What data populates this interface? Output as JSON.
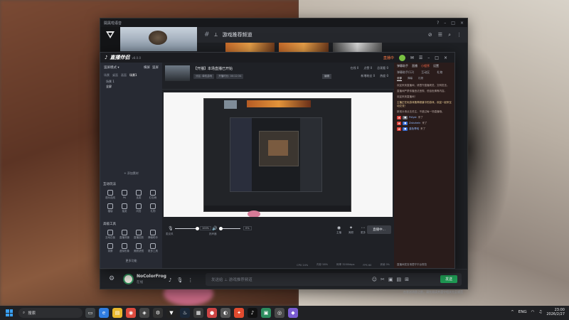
{
  "back_window": {
    "title": "開黑啦语音",
    "channel_name": "游戏推荐频道",
    "channel_prefix": "⊥",
    "input_placeholder": "发送给 ⊥ 游戏推荐频道",
    "send_label": "发送",
    "user": {
      "name": "NoColorFrog",
      "status": "在线"
    },
    "bottom_hint": "在发送消息之前，请先阅读并遵守相关社区规范"
  },
  "front_window": {
    "app_name": "直播伴侣",
    "version": "v8.0.0",
    "live_tag": "直播中",
    "mode_label": "竖屏模式 ▾",
    "mode_tabs": [
      "横屏",
      "竖屏"
    ],
    "scene_tabs": [
      "场景",
      "桌面",
      "画面",
      "场景1"
    ],
    "scenes": [
      {
        "label": "场景 1",
        "selected": false
      },
      {
        "label": "全屏",
        "selected": true
      }
    ],
    "add_source": "+ 添加素材",
    "interact_title": "互动玩法",
    "interact_items": [
      "观众连线",
      "PK",
      "连麦",
      "红包雨",
      "福袋",
      "抽奖",
      "问答",
      "礼物"
    ],
    "tools_title": "高级工具",
    "tools_items": [
      "互动白板",
      "直播测速",
      "直播回放",
      "弹幕助手",
      "录屏",
      "虚拟形象",
      "美颜滤镜",
      "更多工具"
    ],
    "more_label": "更多功能",
    "room_title": "【开播】本场直播已开始",
    "room_tags": [
      "分区: 单机游戏",
      "开播时长: 00:12:34"
    ],
    "room_edit": "编辑",
    "room_stats": [
      "在线 0",
      "点赞 0",
      "总观看 0"
    ],
    "room_stats2": [
      "新增粉丝 0",
      "热度 0"
    ],
    "mic_label": "麦克风",
    "mic_pct": "100%",
    "speaker_label": "扬声器",
    "speaker_pct": "0%",
    "ctl_items": [
      "主播",
      "美颜",
      "更多"
    ],
    "live_button": "直播中...",
    "status_items": [
      "CPU 24%",
      "内存 58%",
      "码率 3200kbps",
      "FPS 60",
      "丢帧 0%"
    ]
  },
  "right_panel": {
    "top_items": [
      "弹幕助手",
      "直播",
      "小程序",
      "设置"
    ],
    "tabs": [
      "弹幕助手(12)",
      "互动区",
      "礼物"
    ],
    "sub_tabs": [
      "全部",
      "弹幕",
      "礼物"
    ],
    "messages": [
      "欢迎来到直播间，请遵守直播规范，文明发言。",
      "直播间严禁传播违法违规、低俗色情等内容。",
      "欢迎来到直播间！",
      "新观众请点击关注，不错过每一场直播哦。"
    ],
    "highlight": "主播正在玩游戏推荐频道中的游戏，欢迎一起来互动交流！",
    "users": [
      {
        "name": "Pdlyst",
        "action": "来了"
      },
      {
        "name": "Zakuhein",
        "action": "来了"
      },
      {
        "name": "蓝色青蛙",
        "action": "来了"
      }
    ],
    "bottom_hint": "直播间发言请遵守平台规范"
  },
  "taskbar": {
    "search_placeholder": "搜索",
    "tray": {
      "lang": "ENG",
      "time": "23:00",
      "date": "2026/2/27"
    }
  },
  "colors": {
    "accent_green": "#1f9d55",
    "live_orange": "#ff7a45",
    "badge_red": "#e0463f",
    "badge_blue": "#3b6fd6"
  }
}
